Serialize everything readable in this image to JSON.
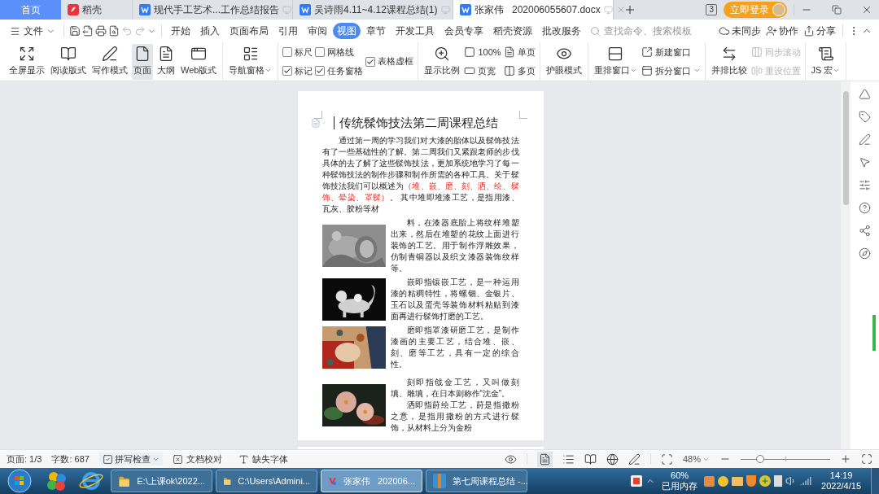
{
  "tabs": [
    {
      "kind": "home",
      "label": "首页",
      "selected": false
    },
    {
      "kind": "app",
      "label": "稻壳",
      "selected": false
    },
    {
      "kind": "document",
      "label": "现代手工艺术...工作总结报告",
      "selected": false
    },
    {
      "kind": "document",
      "label": "吴诗雨4.11~4.12课程总结(1)",
      "selected": false
    },
    {
      "kind": "document",
      "label": "张家伟   202006055607.docx",
      "selected": true
    }
  ],
  "window_count": "3",
  "login_button": "立即登录",
  "file_menu": "文件",
  "menu_tabs": [
    {
      "label": "开始",
      "selected": false
    },
    {
      "label": "插入",
      "selected": false
    },
    {
      "label": "页面布局",
      "selected": false
    },
    {
      "label": "引用",
      "selected": false
    },
    {
      "label": "审阅",
      "selected": false
    },
    {
      "label": "视图",
      "selected": true
    },
    {
      "label": "章节",
      "selected": false
    },
    {
      "label": "开发工具",
      "selected": false
    },
    {
      "label": "会员专享",
      "selected": false
    },
    {
      "label": "稻壳资源",
      "selected": false
    },
    {
      "label": "批改服务",
      "selected": false
    }
  ],
  "search": {
    "placeholder": "查找命令、搜索模板"
  },
  "menu_actions": [
    "未同步",
    "协作",
    "分享"
  ],
  "ribbon": {
    "groups": [
      {
        "items": [
          {
            "kind": "large",
            "label": "全屏显示",
            "selected": false
          },
          {
            "kind": "large",
            "label": "阅读版式",
            "selected": false
          },
          {
            "kind": "large",
            "label": "写作模式",
            "selected": false
          },
          {
            "kind": "large",
            "label": "页面",
            "selected": true
          },
          {
            "kind": "large",
            "label": "大纲",
            "selected": false
          },
          {
            "kind": "large",
            "label": "Web版式",
            "selected": false
          }
        ]
      },
      {
        "items": [
          {
            "kind": "large",
            "label": "导航窗格",
            "dropdown": true
          }
        ]
      },
      {
        "items": [
          {
            "kind": "stack",
            "items": [
              {
                "kind": "check",
                "label": "标尺",
                "checked": false
              },
              {
                "kind": "check",
                "label": "标记",
                "checked": true
              }
            ]
          },
          {
            "kind": "stack",
            "items": [
              {
                "kind": "check",
                "label": "网格线",
                "checked": false
              },
              {
                "kind": "check",
                "label": "任务窗格",
                "checked": true
              }
            ]
          },
          {
            "kind": "stack",
            "items": [
              {
                "kind": "check",
                "label": "表格虚框",
                "checked": true
              }
            ]
          }
        ]
      },
      {
        "items": [
          {
            "kind": "large",
            "label": "显示比例"
          },
          {
            "kind": "stack",
            "items": [
              {
                "kind": "small",
                "label": "100%"
              },
              {
                "kind": "small",
                "label": "页宽"
              }
            ]
          },
          {
            "kind": "stack",
            "items": [
              {
                "kind": "small",
                "label": "单页"
              },
              {
                "kind": "small",
                "label": "多页"
              }
            ]
          }
        ]
      },
      {
        "items": [
          {
            "kind": "large",
            "label": "护眼模式"
          }
        ]
      },
      {
        "items": [
          {
            "kind": "large",
            "label": "重排窗口",
            "dropdown": true
          },
          {
            "kind": "stack",
            "items": [
              {
                "kind": "small",
                "label": "新建窗口"
              },
              {
                "kind": "small",
                "label": "拆分窗口",
                "dropdown": true
              }
            ]
          }
        ]
      },
      {
        "items": [
          {
            "kind": "large",
            "label": "并排比较"
          },
          {
            "kind": "stack",
            "items": [
              {
                "kind": "small",
                "label": "同步滚动",
                "disabled": true
              },
              {
                "kind": "small",
                "label": "重设位置",
                "disabled": true
              }
            ]
          }
        ]
      },
      {
        "items": [
          {
            "kind": "large",
            "label": "JS 宏",
            "dropdown": true
          }
        ]
      }
    ]
  },
  "document": {
    "title": "传统髹饰技法第二周课程总结",
    "intro": [
      {
        "text": "通过第一周的学习我们对大漆的胎体以及髹饰技法有了一些基础性的了解。第二周我们又紧跟老师的步伐具体的去了解了这些髹饰技法，更加系统地学习了每一种髹饰技法的制作步骤和制作所需的各种工具。关于髹饰技法我们可以概述为",
        "emphasis": false
      },
      {
        "text": "（堆、嵌、磨、刻、洒、绘、髹饰、晕染、罩髹）",
        "emphasis": true
      },
      {
        "text": "。 其中堆即堆漆工艺，是指用漆、瓦灰、胶粉等材",
        "emphasis": false
      }
    ],
    "blocks": [
      {
        "paragraphs": [
          "料，在漆器底胎上将纹样堆塑出来，然后在堆塑的花纹上面进行装饰的工艺。用于制作浮雕效果，仿制青铜器以及织文漆器装饰纹样等。"
        ]
      },
      {
        "paragraphs": [
          "嵌即指镶嵌工艺，是一种运用漆的粘稠特性，将螺钿、金银片、玉石以及蛋壳等装饰材料粘贴到漆面再进行髹饰打磨的工艺。"
        ]
      },
      {
        "paragraphs": [
          "磨即指罩漆研磨工艺，是制作漆画的主要工艺，结合堆、嵌、刻、磨等工艺，具有一定的综合性。"
        ]
      },
      {
        "paragraphs": [
          "刻即指戗金工艺，又叫做刻填、雕填，在日本则称作“沈金”。",
          "洒即指莳绘工艺，莳是指撒粉之意，是指用撒粉的方式进行髹饰，从材料上分为金粉"
        ]
      }
    ]
  },
  "status_bar": {
    "page": "页面: 1/3",
    "word_count": "字数: 687",
    "spell_check": "拼写检查",
    "proofread": "文档校对",
    "missing_fonts": "缺失字体",
    "zoom": "48%",
    "zoom_slider": {
      "level": 0.22
    }
  },
  "taskbar": {
    "windows": [
      {
        "label": "E:\\上课ok\\2022...",
        "selected": false
      },
      {
        "label": "C:\\Users\\Admini...",
        "selected": false
      },
      {
        "label": "张家伟   202006...",
        "selected": true
      },
      {
        "label": "第七周课程总结 -...",
        "selected": false
      }
    ],
    "memory": {
      "percent": "60%",
      "label": "已用内存"
    },
    "time": "14:19",
    "date": "2022/4/15"
  }
}
